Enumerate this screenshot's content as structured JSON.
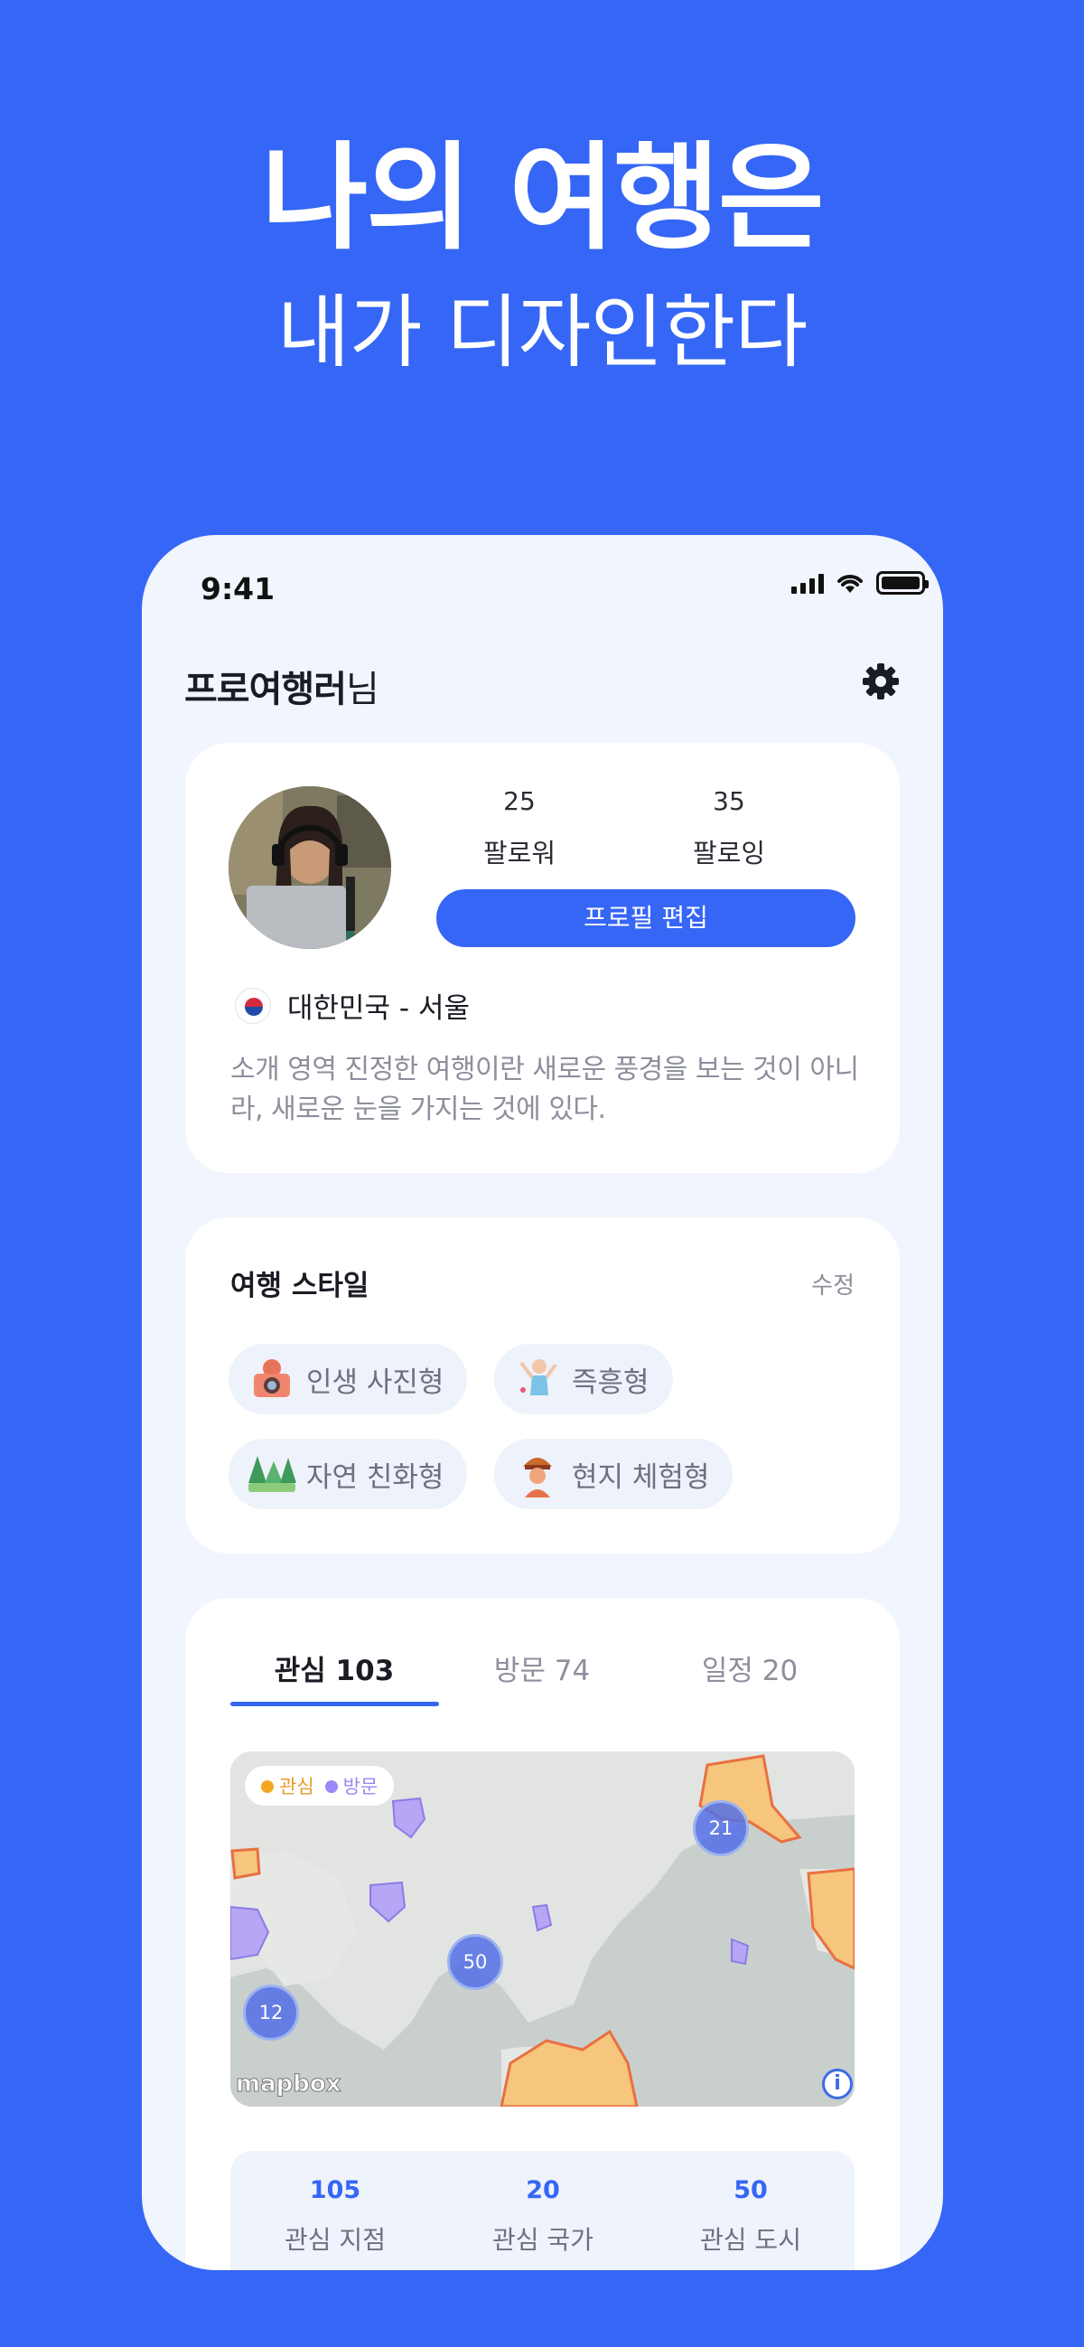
{
  "hero": {
    "title": "나의 여행은",
    "subtitle": "내가 디자인한다"
  },
  "status_bar": {
    "time": "9:41"
  },
  "header": {
    "name": "프로여행러",
    "suffix": "님"
  },
  "profile": {
    "followers": {
      "count": "25",
      "label": "팔로워"
    },
    "following": {
      "count": "35",
      "label": "팔로잉"
    },
    "edit_button": "프로필 편집",
    "location": "대한민국 - 서울",
    "bio": "소개 영역 진정한 여행이란 새로운 풍경을 보는 것이 아니라, 새로운 눈을 가지는 것에 있다."
  },
  "travel_style": {
    "title": "여행 스타일",
    "edit": "수정",
    "chips": [
      {
        "label": "인생 사진형",
        "icon": "camera-icon"
      },
      {
        "label": "즉흥형",
        "icon": "dancer-icon"
      },
      {
        "label": "자연 친화형",
        "icon": "trees-icon"
      },
      {
        "label": "현지 체험형",
        "icon": "native-person-icon"
      }
    ]
  },
  "tabs": [
    {
      "label": "관심 103"
    },
    {
      "label": "방문 74"
    },
    {
      "label": "일정 20"
    }
  ],
  "map": {
    "legend_interest": "관심",
    "legend_visited": "방문",
    "interest_color": "#F5A623",
    "visited_color": "#9B87F5",
    "clusters": [
      "21",
      "50",
      "12"
    ],
    "attribution": "mapbox"
  },
  "summary": [
    {
      "value": "105",
      "label": "관심 지점"
    },
    {
      "value": "20",
      "label": "관심 국가"
    },
    {
      "value": "50",
      "label": "관심 도시"
    }
  ],
  "colors": {
    "brand": "#3566F5",
    "background": "#F1F5FD"
  }
}
